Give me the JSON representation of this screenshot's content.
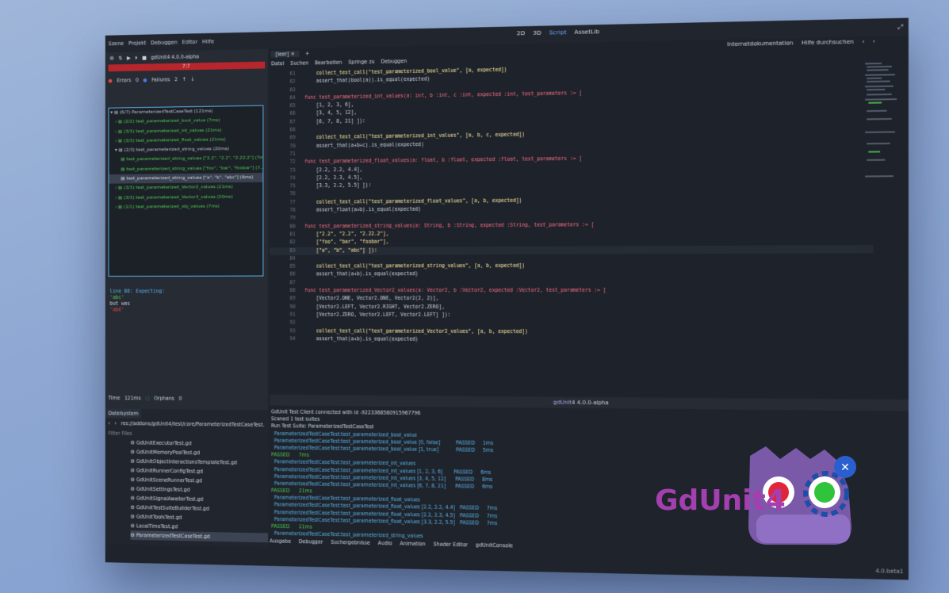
{
  "topbar": {
    "menu": [
      "Szene",
      "Projekt",
      "Debuggen",
      "Editor",
      "Hilfe"
    ],
    "workspaces": [
      "2D",
      "3D",
      "Script",
      "AssetLib"
    ],
    "active_workspace": "Script"
  },
  "gdunit": {
    "title": "gdUnit4 4.0.0-alpha",
    "progress_text": "7:7",
    "errors_label": "Errors",
    "errors_count": "0",
    "failures_label": "Failures",
    "failures_count": "2"
  },
  "test_tree": [
    "(6/7) ParameterizedTestCaseTest (121ms)",
    "(2/2) test_parameterized_bool_value (7ms)",
    "(3/3) test_parameterized_int_values (21ms)",
    "(3/3) test_parameterized_float_values (21ms)",
    "(2/3) test_parameterized_string_values (20ms)",
    "test_parameterized_string_values [\"2.2\", \"2.2\", \"2.22.2\"] (7ms)",
    "test_parameterized_string_values [\"foo\", \"bar\", \"foobar\"] (7...",
    "test_parameterized_string_values [\"a\", \"b\", \"abc\"] (6ms)",
    "(3/3) test_parameterized_Vector2_values (21ms)",
    "(3/3) test_parameterized_Vector3_values (20ms)",
    "(1/1) test_parameterized_obj_values (7ms)"
  ],
  "failure": {
    "line1": "line 86: Expecting:",
    "line2": " 'abc'",
    "line3": " but was",
    "line4": " 'abé'"
  },
  "timebar": {
    "time_label": "Time",
    "time_value": "121ms",
    "orphans_label": "Orphans",
    "orphans_value": "0"
  },
  "filesystem": {
    "tab": "Dateisystem",
    "path": "res://addons/gdUnit4/test/core/ParameterizedTestCaseTest.",
    "filter": "Filter Files",
    "files": [
      "GdUnitExecutorTest.gd",
      "GdUnitMemoryPoolTest.gd",
      "GdUnitObjectInteractionsTemplateTest.gd",
      "GdUnitRunnerConfigTest.gd",
      "GdUnitSceneRunnerTest.gd",
      "GdUnitSettingsTest.gd",
      "GdUnitSignalAwaiterTest.gd",
      "GdUnitTestSuiteBuilderTest.gd",
      "GdUnitToolsTest.gd",
      "LocalTimeTest.gd",
      "ParameterizedTestCaseTest.gd"
    ]
  },
  "editor": {
    "tab": "[leer]",
    "docs": [
      "Internetdokumentation",
      "Hilfe durchsuchen"
    ],
    "submenu": [
      "Datei",
      "Suchen",
      "Bearbeiten",
      "Springe zu",
      "Debuggen"
    ],
    "cursor_line": "83",
    "cursor_col": "28",
    "lines": [
      {
        "n": "61",
        "t": "    collect_test_call(\"test_parameterized_bool_value\", [a, expected])"
      },
      {
        "n": "62",
        "t": "    assert_that(bool(a)).is_equal(expected)"
      },
      {
        "n": "63",
        "t": ""
      },
      {
        "n": "64",
        "t": "func test_parameterized_int_values(a: int, b :int, c :int, expected :int, test_parameters := ["
      },
      {
        "n": "65",
        "t": "    [1, 2, 3, 6],"
      },
      {
        "n": "66",
        "t": "    [3, 4, 5, 12],"
      },
      {
        "n": "67",
        "t": "    [6, 7, 8, 21] ]):"
      },
      {
        "n": "68",
        "t": ""
      },
      {
        "n": "69",
        "t": "    collect_test_call(\"test_parameterized_int_values\", [a, b, c, expected])"
      },
      {
        "n": "70",
        "t": "    assert_that(a+b+c).is_equal(expected)"
      },
      {
        "n": "71",
        "t": ""
      },
      {
        "n": "72",
        "t": "func test_parameterized_float_values(a: float, b :float, expected :float, test_parameters := ["
      },
      {
        "n": "73",
        "t": "    [2.2, 2.2, 4.4],"
      },
      {
        "n": "74",
        "t": "    [2.2, 2.3, 4.5],"
      },
      {
        "n": "75",
        "t": "    [3.3, 2.2, 5.5] ]):"
      },
      {
        "n": "76",
        "t": ""
      },
      {
        "n": "77",
        "t": "    collect_test_call(\"test_parameterized_float_values\", [a, b, expected])"
      },
      {
        "n": "78",
        "t": "    assert_float(a+b).is_equal(expected)"
      },
      {
        "n": "79",
        "t": ""
      },
      {
        "n": "80",
        "t": "func test_parameterized_string_values(a: String, b :String, expected :String, test_parameters := ["
      },
      {
        "n": "81",
        "t": "    [\"2.2\", \"2.2\", \"2.22.2\"],"
      },
      {
        "n": "82",
        "t": "    [\"foo\", \"bar\", \"foobar\"],"
      },
      {
        "n": "83",
        "t": "    [\"a\", \"b\", \"abc\"] ]):"
      },
      {
        "n": "84",
        "t": ""
      },
      {
        "n": "85",
        "t": "    collect_test_call(\"test_parameterized_string_values\", [a, b, expected])"
      },
      {
        "n": "86",
        "t": "    assert_that(a+b).is_equal(expected)"
      },
      {
        "n": "87",
        "t": ""
      },
      {
        "n": "88",
        "t": "func test_parameterized_Vector2_values(a: Vector2, b :Vector2, expected :Vector2, test_parameters := ["
      },
      {
        "n": "89",
        "t": "    [Vector2.ONE, Vector2.ONE, Vector2(2, 2)],"
      },
      {
        "n": "90",
        "t": "    [Vector2.LEFT, Vector2.RIGHT, Vector2.ZERO],"
      },
      {
        "n": "91",
        "t": "    [Vector2.ZERO, Vector2.LEFT, Vector2.LEFT] ]):"
      },
      {
        "n": "92",
        "t": ""
      },
      {
        "n": "93",
        "t": "    collect_test_call(\"test_parameterized_Vector2_values\", [a, b, expected])"
      },
      {
        "n": "94",
        "t": "    assert_that(a+b).is_equal(expected)"
      }
    ]
  },
  "console": {
    "title_prefix": "gdUnit",
    "title_rest": "4 4.0.0-alpha",
    "lines": [
      {
        "cls": "",
        "t": "GdUnit Test Client connected with id -9223368580915967796"
      },
      {
        "cls": "",
        "t": "Scaned 1 test suites"
      },
      {
        "cls": "",
        "t": "Run Test Suite: ParameterizedTestCaseTest"
      },
      {
        "cls": "c-cyan",
        "t": "  ParameterizedTestCaseTest:test_parameterized_bool_value"
      },
      {
        "cls": "c-cyan",
        "t": "  ParameterizedTestCaseTest:test_parameterized_bool_value [0, false]          PASSED     1ms"
      },
      {
        "cls": "c-cyan",
        "t": "  ParameterizedTestCaseTest:test_parameterized_bool_value [1, true]           PASSED     5ms"
      },
      {
        "cls": "c-green",
        "t": "PASSED      7ms"
      },
      {
        "cls": "c-cyan",
        "t": "  ParameterizedTestCaseTest:test_parameterized_int_values"
      },
      {
        "cls": "c-cyan",
        "t": "  ParameterizedTestCaseTest:test_parameterized_int_values [1, 2, 3, 6]       PASSED     6ms"
      },
      {
        "cls": "c-cyan",
        "t": "  ParameterizedTestCaseTest:test_parameterized_int_values [3, 4, 5, 12]      PASSED     8ms"
      },
      {
        "cls": "c-cyan",
        "t": "  ParameterizedTestCaseTest:test_parameterized_int_values [6, 7, 8, 21]      PASSED     6ms"
      },
      {
        "cls": "c-green",
        "t": "PASSED      21ms"
      },
      {
        "cls": "c-cyan",
        "t": "  ParameterizedTestCaseTest:test_parameterized_float_values"
      },
      {
        "cls": "c-cyan",
        "t": "  ParameterizedTestCaseTest:test_parameterized_float_values [2.2, 2.2, 4.4]   PASSED     7ms"
      },
      {
        "cls": "c-cyan",
        "t": "  ParameterizedTestCaseTest:test_parameterized_float_values [2.2, 2.3, 4.5]   PASSED     7ms"
      },
      {
        "cls": "c-cyan",
        "t": "  ParameterizedTestCaseTest:test_parameterized_float_values [3.3, 2.2, 5.5]   PASSED     7ms"
      },
      {
        "cls": "c-green",
        "t": "PASSED      21ms"
      },
      {
        "cls": "c-cyan",
        "t": "  ParameterizedTestCaseTest:test_parameterized_string_values"
      }
    ]
  },
  "bottom_tabs": [
    "Ausgabe",
    "Debugger",
    "Suchergebnisse",
    "Audio",
    "Animation",
    "Shader Editor",
    "gdUnitConsole"
  ],
  "version": "4.0.beta1",
  "logo_text": "GdUnit4",
  "colors": {
    "accent": "#5ab4e8",
    "pass": "#4fca4f",
    "fail": "#b7262c",
    "keyword": "#ff7085",
    "logo": "#a43fb0"
  }
}
